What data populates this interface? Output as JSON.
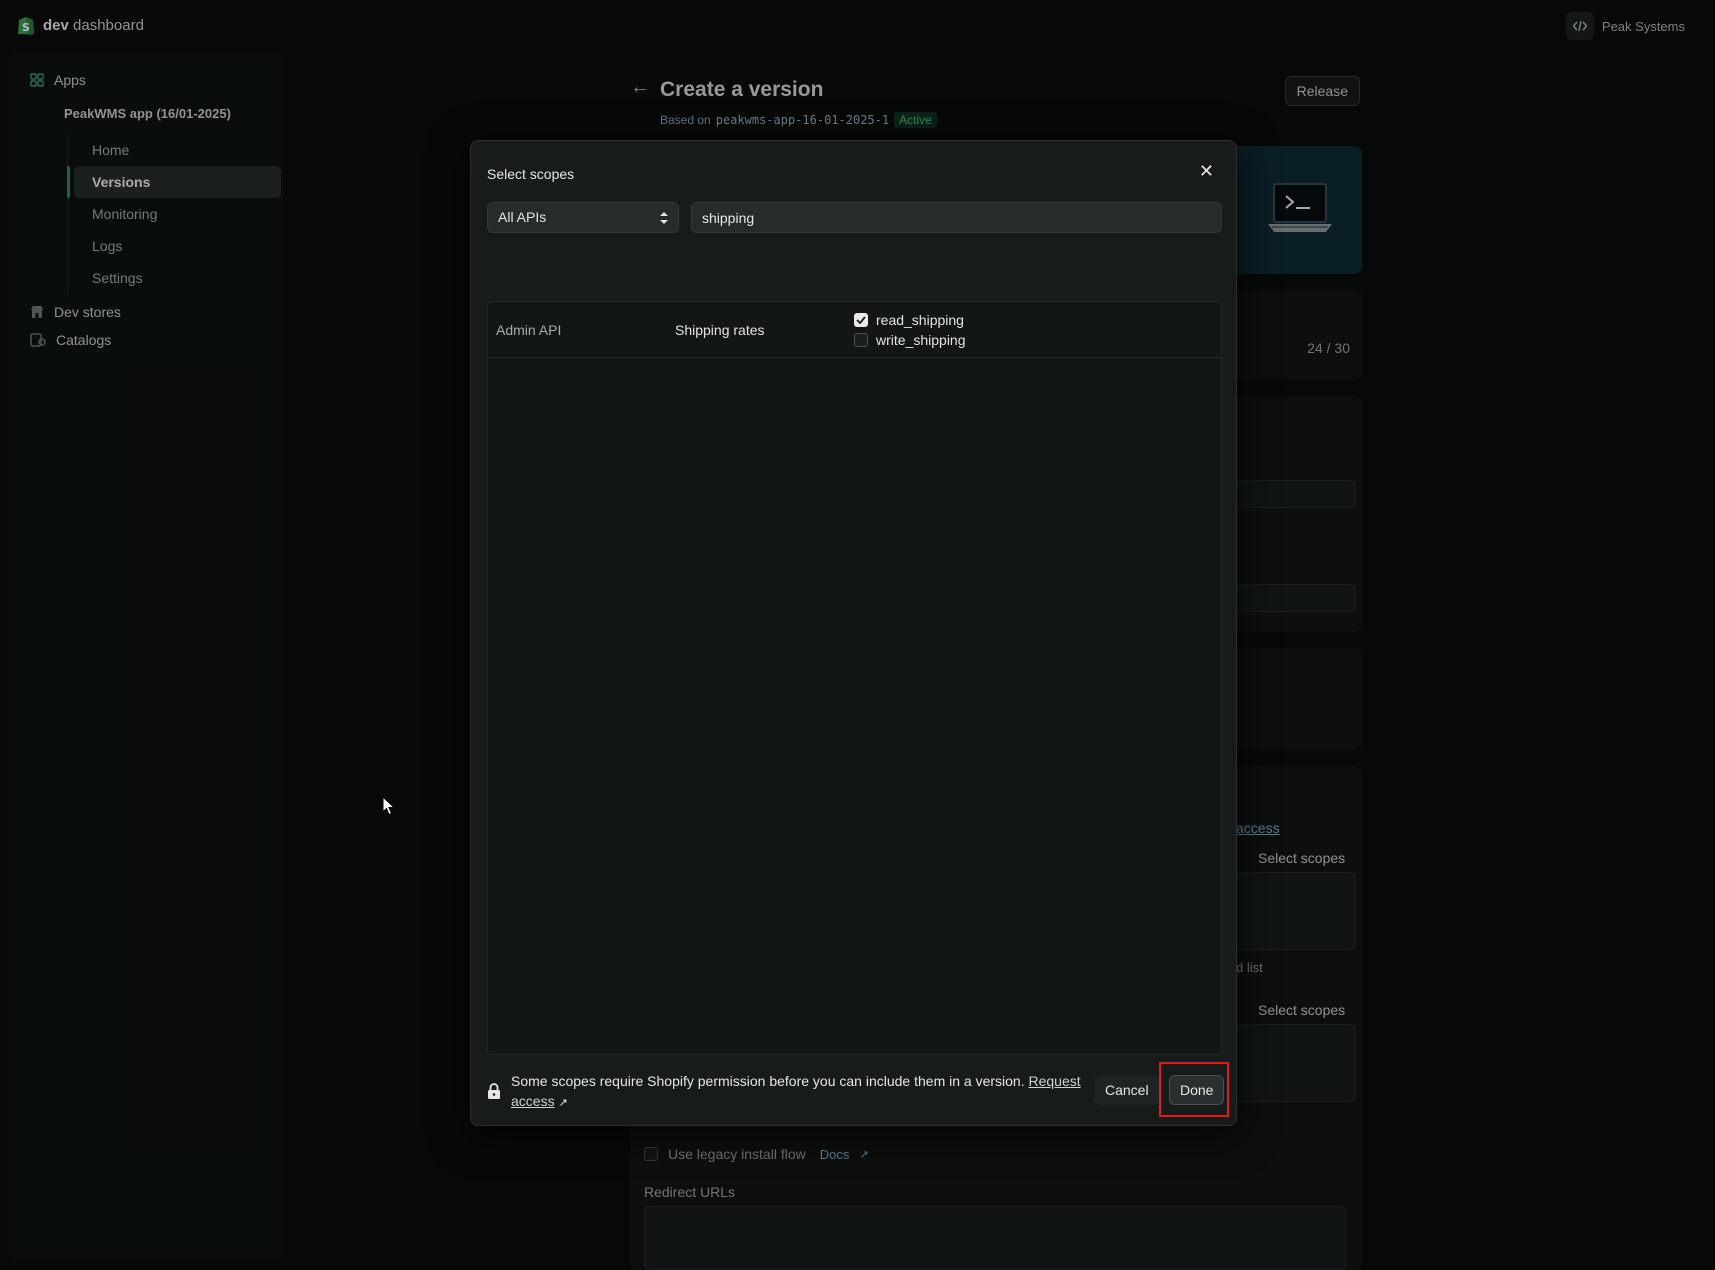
{
  "header": {
    "logo_bold": "dev",
    "logo_rest": " dashboard",
    "org_name": "Peak Systems"
  },
  "sidebar": {
    "apps_label": "Apps",
    "app_name": "PeakWMS app (16/01-2025)",
    "items": [
      {
        "label": "Home",
        "active": false
      },
      {
        "label": "Versions",
        "active": true
      },
      {
        "label": "Monitoring",
        "active": false
      },
      {
        "label": "Logs",
        "active": false
      },
      {
        "label": "Settings",
        "active": false
      }
    ],
    "dev_stores_label": "Dev stores",
    "catalogs_label": "Catalogs"
  },
  "page": {
    "title": "Create a version",
    "based_on_prefix": "Based on",
    "based_on_version": "peakwms-app-16-01-2025-1",
    "status_badge": "Active",
    "release_label": "Release",
    "counter": "24 / 30",
    "access_link": "access",
    "select_scopes_1": "Select scopes",
    "list_fragment": "d list",
    "select_scopes_2": "Select scopes",
    "legacy_label": "Use legacy install flow",
    "docs_label": "Docs",
    "redirect_label": "Redirect URLs"
  },
  "modal": {
    "title": "Select scopes",
    "api_filter": "All APIs",
    "search_value": "shipping",
    "rows": [
      {
        "api": "Admin API",
        "resource": "Shipping rates",
        "scopes": [
          {
            "name": "read_shipping",
            "checked": true
          },
          {
            "name": "write_shipping",
            "checked": false
          }
        ]
      }
    ],
    "footer_note": "Some scopes require Shopify permission before you can include them in a version.",
    "request_access": "Request access",
    "cancel_label": "Cancel",
    "done_label": "Done"
  },
  "colors": {
    "accent": "#2a8b68",
    "highlight": "#e21a1a",
    "active_badge": "#3ec07c"
  }
}
